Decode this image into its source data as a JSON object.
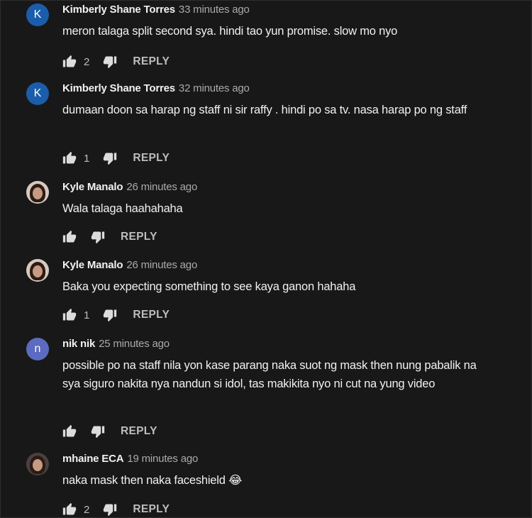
{
  "comments": [
    {
      "author": "Kimberly Shane Torres",
      "time": "33 minutes ago",
      "text": "meron talaga split second sya. hindi tao yun promise. slow mo nyo",
      "likes": "2",
      "avatar_letter": "K",
      "avatar_color": "#1b5dab"
    },
    {
      "author": "Kimberly Shane Torres",
      "time": "32 minutes ago",
      "text": "dumaan doon sa harap ng staff ni sir raffy . hindi po sa tv. nasa harap po ng staff",
      "likes": "1",
      "avatar_letter": "K",
      "avatar_color": "#1b5dab"
    },
    {
      "author": "Kyle Manalo",
      "time": "26 minutes ago",
      "text": "Wala talaga haahahaha",
      "likes": "",
      "avatar_letter": "",
      "avatar_color": ""
    },
    {
      "author": "Kyle Manalo",
      "time": "26 minutes ago",
      "text": "Baka you expecting something to see kaya ganon hahaha",
      "likes": "1",
      "avatar_letter": "",
      "avatar_color": ""
    },
    {
      "author": "nik nik",
      "time": "25 minutes ago",
      "text": "possible po na staff nila yon kase parang naka suot ng mask then nung pabalik na sya siguro nakita nya nandun si idol, tas makikita nyo ni cut na yung video",
      "likes": "",
      "avatar_letter": "n",
      "avatar_color": "#5c6bc0"
    },
    {
      "author": "mhaine ECA",
      "time": "19 minutes ago",
      "text": "naka mask then naka faceshield 😂",
      "likes": "2",
      "avatar_letter": "",
      "avatar_color": ""
    }
  ],
  "reply_label": "REPLY",
  "icons": {
    "like": "thumbs-up-icon",
    "dislike": "thumbs-down-icon"
  }
}
